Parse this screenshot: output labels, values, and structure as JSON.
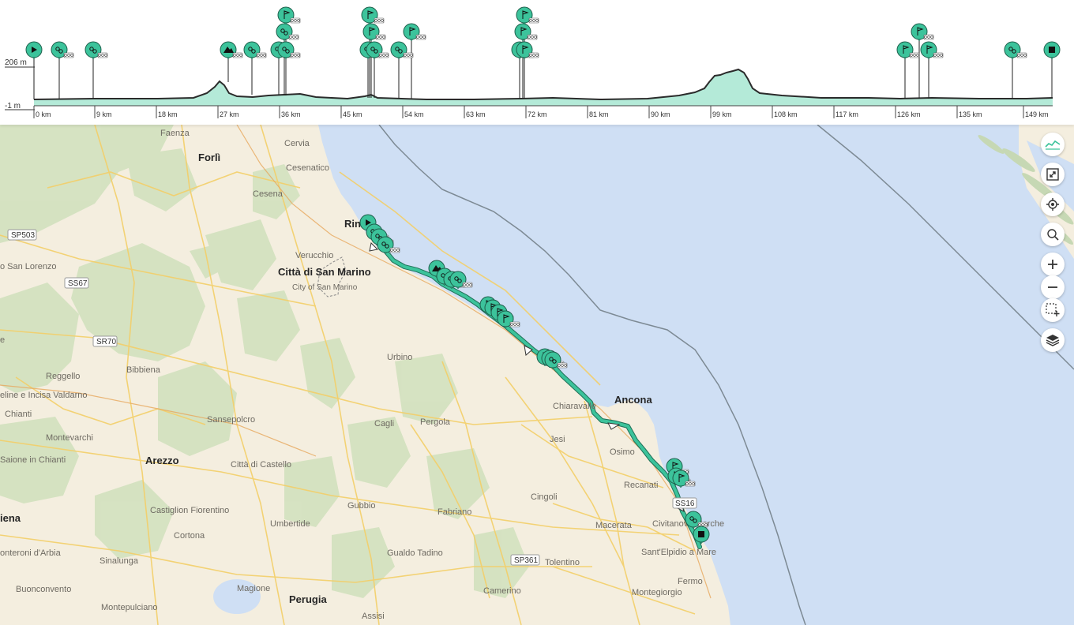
{
  "elevation_profile": {
    "y_max_label": "206 m",
    "y_min_label": "-1 m",
    "x_ticks": [
      "0 km",
      "9 km",
      "18 km",
      "27 km",
      "36 km",
      "45 km",
      "54 km",
      "63 km",
      "72 km",
      "81 km",
      "90 km",
      "99 km",
      "108 km",
      "117 km",
      "126 km",
      "135 km",
      "149 km"
    ],
    "line_color": "#2b2b2b",
    "fill_color": "#b4ead8",
    "marker_color": "#3cc39b"
  },
  "map": {
    "sea_color": "#cfdff4",
    "land_color": "#f4eedf",
    "route_color": "#2fa07d",
    "cities": [
      {
        "name": "Forlì",
        "id": "forli"
      },
      {
        "name": "Città di San Marino",
        "id": "sanmarino"
      },
      {
        "name": "City of San Marino",
        "id": "sanmarino-en"
      },
      {
        "name": "Ancona",
        "id": "ancona"
      },
      {
        "name": "Arezzo",
        "id": "arezzo"
      },
      {
        "name": "Perugia",
        "id": "perugia"
      },
      {
        "name": "Rin",
        "id": "rimini-cut"
      },
      {
        "name": "iena",
        "id": "siena-cut"
      }
    ],
    "towns": [
      "Faenza",
      "Cervia",
      "Cesenatico",
      "Cesena",
      "Verucchio",
      "o San Lorenzo",
      "Bibbiena",
      "Reggello",
      "eline e Incisa Valdarno",
      "Chianti",
      "Montevarchi",
      "Saione in Chianti",
      "Sansepolcro",
      "Urbino",
      "Cagli",
      "Pergola",
      "Jesi",
      "Chiaravalle",
      "Osimo",
      "Recanati",
      "Cingoli",
      "Fabriano",
      "Macerata",
      "Civitanova Marche",
      "Sant'Elpidio a Mare",
      "Città di Castello",
      "Castiglion Fiorentino",
      "Cortona",
      "Umbertide",
      "Gubbio",
      "Gualdo Tadino",
      "Tolentino",
      "Camerino",
      "Montegiorgio",
      "Fermo",
      "Sinalunga",
      "Magione",
      "Buonconvento",
      "Montepulciano",
      "onteroni d'Arbia",
      "Assisi",
      "e"
    ],
    "roads": [
      "SP503",
      "SS67",
      "SR70",
      "SP361",
      "SS16"
    ]
  },
  "controls": {
    "elevation_toggle": "elevation-icon",
    "fullscreen": "fullscreen-icon",
    "locate": "locate-icon",
    "search": "search-icon",
    "zoom_in": "plus-icon",
    "zoom_out": "minus-icon",
    "select_area": "select-area-icon",
    "layers": "layers-icon"
  }
}
